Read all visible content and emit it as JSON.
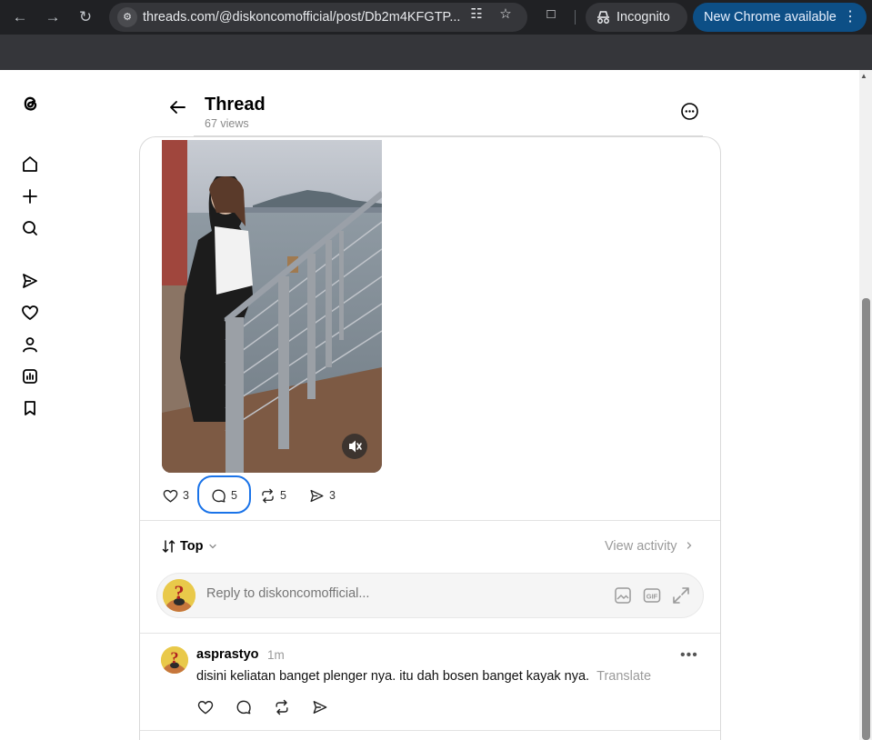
{
  "browser": {
    "url": "threads.com/@diskoncomofficial/post/Db2m4KFGTP...",
    "incognito_label": "Incognito",
    "update_label": "New Chrome available",
    "accent": "#0d4f86"
  },
  "sidebar": {
    "items": [
      {
        "icon": "threads-logo-icon"
      },
      {
        "icon": "home-icon"
      },
      {
        "icon": "create-icon"
      },
      {
        "icon": "search-icon"
      },
      {
        "icon": "send-icon"
      },
      {
        "icon": "heart-icon"
      },
      {
        "icon": "profile-icon"
      },
      {
        "icon": "insights-icon"
      },
      {
        "icon": "bookmark-icon"
      }
    ]
  },
  "header": {
    "title": "Thread",
    "views": "67 views"
  },
  "post": {
    "likes": "3",
    "comments": "5",
    "reposts": "5",
    "shares": "3"
  },
  "sort": {
    "label": "Top",
    "view_activity": "View activity"
  },
  "reply": {
    "placeholder": "Reply to diskoncomofficial..."
  },
  "comment": {
    "username": "asprastyo",
    "time": "1m",
    "text": "disini keliatan banget plenger nya. itu dah bosen banget kayak nya.",
    "translate": "Translate"
  }
}
